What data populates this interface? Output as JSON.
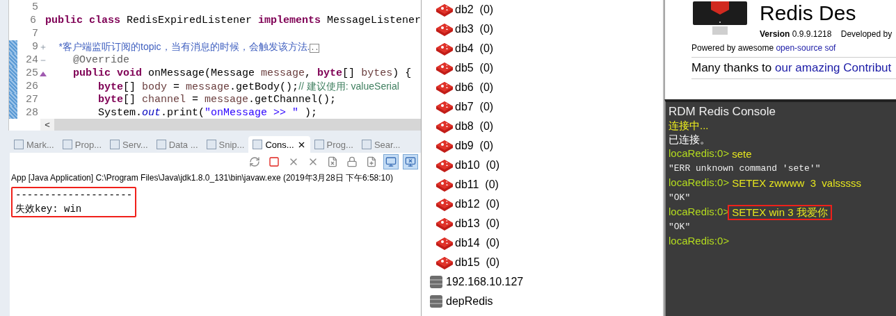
{
  "editor": {
    "lines": [
      {
        "number": "5",
        "changed": false,
        "kind": "plain"
      },
      {
        "number": "6",
        "changed": false,
        "kind": "plain",
        "tokens": [
          {
            "kind": "keyword",
            "text": "public class"
          },
          {
            "kind": "plain",
            "text": " RedisExpiredListener "
          },
          {
            "kind": "keyword",
            "text": "implements"
          },
          {
            "kind": "plain",
            "text": " MessageListener"
          }
        ]
      },
      {
        "number": "7",
        "changed": false,
        "kind": "plain"
      },
      {
        "number": "9",
        "changed": true,
        "kind": "expand",
        "tokens": [
          {
            "kind": "javadoc",
            "text": "    *客户端监听订阅的topic，当有消息的时候，会触发该方法."
          },
          {
            "kind": "folded",
            "text": ".."
          }
        ]
      },
      {
        "number": "24",
        "changed": true,
        "kind": "collapse",
        "tokens": [
          {
            "kind": "annotation",
            "text": "    @Override"
          }
        ]
      },
      {
        "number": "25",
        "changed": true,
        "kind": "override",
        "tokens": [
          {
            "kind": "keyword",
            "text": "    public void"
          },
          {
            "kind": "plain",
            "text": " onMessage(Message "
          },
          {
            "kind": "variable",
            "text": "message"
          },
          {
            "kind": "plain",
            "text": ", "
          },
          {
            "kind": "keyword",
            "text": "byte"
          },
          {
            "kind": "plain",
            "text": "[] "
          },
          {
            "kind": "variable",
            "text": "bytes"
          },
          {
            "kind": "plain",
            "text": ") {"
          }
        ]
      },
      {
        "number": "26",
        "changed": true,
        "kind": "plain",
        "tokens": [
          {
            "kind": "keyword",
            "text": "        byte"
          },
          {
            "kind": "plain",
            "text": "[] "
          },
          {
            "kind": "variable",
            "text": "body"
          },
          {
            "kind": "plain",
            "text": " = "
          },
          {
            "kind": "variable",
            "text": "message"
          },
          {
            "kind": "plain",
            "text": ".getBody();"
          },
          {
            "kind": "comment",
            "text": "// 建议使用: valueSerial"
          }
        ]
      },
      {
        "number": "27",
        "changed": true,
        "kind": "plain",
        "tokens": [
          {
            "kind": "keyword",
            "text": "        byte"
          },
          {
            "kind": "plain",
            "text": "[] "
          },
          {
            "kind": "variable",
            "text": "channel"
          },
          {
            "kind": "plain",
            "text": " = "
          },
          {
            "kind": "variable",
            "text": "message"
          },
          {
            "kind": "plain",
            "text": ".getChannel();"
          }
        ]
      },
      {
        "number": "28",
        "changed": true,
        "kind": "plain",
        "tokens": [
          {
            "kind": "plain",
            "text": "        System."
          },
          {
            "kind": "field",
            "text": "out"
          },
          {
            "kind": "plain",
            "text": ".print("
          },
          {
            "kind": "string",
            "text": "\"onMessage >> \""
          },
          {
            "kind": "plain",
            "text": " );"
          }
        ]
      }
    ],
    "scroll_left": "<"
  },
  "views": [
    {
      "label": "Mark...",
      "selected": false
    },
    {
      "label": "Prop...",
      "selected": false
    },
    {
      "label": "Serv...",
      "selected": false
    },
    {
      "label": "Data ...",
      "selected": false
    },
    {
      "label": "Snip...",
      "selected": false
    },
    {
      "label": "Cons...",
      "selected": true
    },
    {
      "label": "Prog...",
      "selected": false
    },
    {
      "label": "Sear...",
      "selected": false
    }
  ],
  "console": {
    "header": "App [Java Application] C:\\Program Files\\Java\\jdk1.8.0_131\\bin\\javaw.exe (2019年3月28日 下午6:58:10)",
    "output": [
      "--------------------",
      "失效key: win"
    ],
    "highlight": true
  },
  "tree": {
    "databases": [
      {
        "name": "db2",
        "count": "(0)"
      },
      {
        "name": "db3",
        "count": "(0)"
      },
      {
        "name": "db4",
        "count": "(0)"
      },
      {
        "name": "db5",
        "count": "(0)"
      },
      {
        "name": "db6",
        "count": "(0)"
      },
      {
        "name": "db7",
        "count": "(0)"
      },
      {
        "name": "db8",
        "count": "(0)"
      },
      {
        "name": "db9",
        "count": "(0)"
      },
      {
        "name": "db10",
        "count": "(0)"
      },
      {
        "name": "db11",
        "count": "(0)"
      },
      {
        "name": "db12",
        "count": "(0)"
      },
      {
        "name": "db13",
        "count": "(0)"
      },
      {
        "name": "db14",
        "count": "(0)"
      },
      {
        "name": "db15",
        "count": "(0)"
      }
    ],
    "connections": [
      {
        "name": "192.168.10.127"
      },
      {
        "name": "depRedis"
      }
    ]
  },
  "about": {
    "title": "Redis Des",
    "version_label": "Version",
    "version": "0.9.9.1218",
    "developed": "Developed by",
    "powered": "Powered by awesome ",
    "powered_link": "open-source sof",
    "thanks": "Many thanks to ",
    "thanks_link": "our amazing Contribut"
  },
  "redis_console": {
    "title": "RDM Redis Console",
    "lines": [
      {
        "kind": "status",
        "text": "连接中..."
      },
      {
        "kind": "info",
        "text": "已连接。"
      },
      {
        "kind": "command",
        "prompt": "locaRedis:0>",
        "text": "sete",
        "highlight": false
      },
      {
        "kind": "reply",
        "text": "\"ERR unknown command 'sete'\""
      },
      {
        "kind": "command",
        "prompt": "locaRedis:0>",
        "text": "SETEX zwwww  3  valsssss",
        "highlight": false
      },
      {
        "kind": "reply",
        "text": "\"OK\""
      },
      {
        "kind": "command",
        "prompt": "locaRedis:0>",
        "text": "SETEX win 3 我爱你",
        "highlight": true
      },
      {
        "kind": "reply",
        "text": "\"OK\""
      },
      {
        "kind": "command",
        "prompt": "locaRedis:0>"
      }
    ]
  }
}
